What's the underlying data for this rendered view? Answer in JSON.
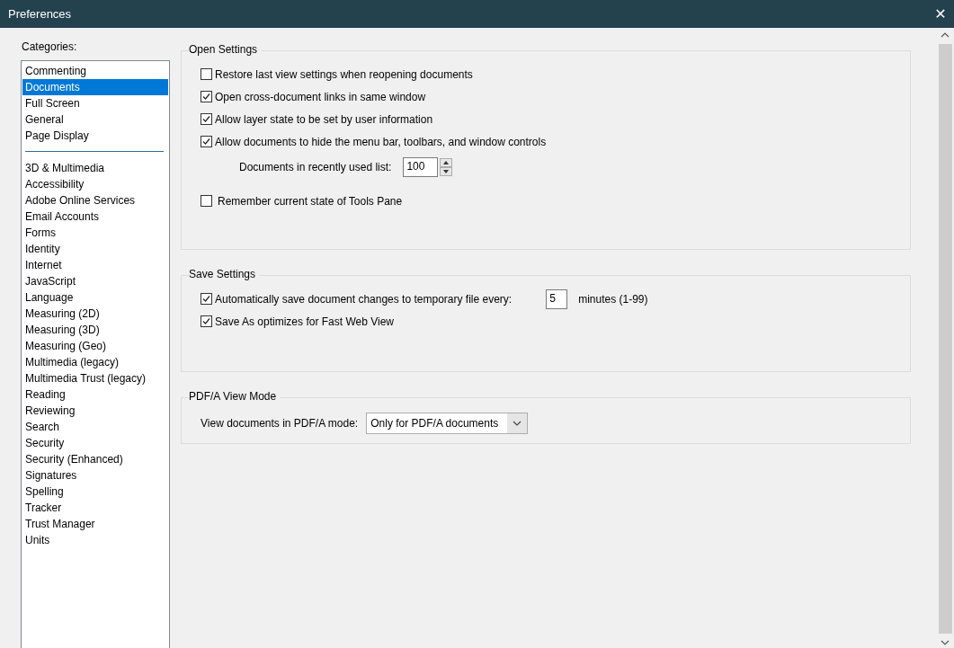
{
  "window": {
    "title": "Preferences",
    "close_glyph": "✕"
  },
  "categories": {
    "label": "Categories:",
    "groups": [
      [
        {
          "label": "Commenting",
          "selected": false
        },
        {
          "label": "Documents",
          "selected": true
        },
        {
          "label": "Full Screen",
          "selected": false
        },
        {
          "label": "General",
          "selected": false
        },
        {
          "label": "Page Display",
          "selected": false
        }
      ],
      [
        {
          "label": "3D & Multimedia",
          "selected": false
        },
        {
          "label": "Accessibility",
          "selected": false
        },
        {
          "label": "Adobe Online Services",
          "selected": false
        },
        {
          "label": "Email Accounts",
          "selected": false
        },
        {
          "label": "Forms",
          "selected": false
        },
        {
          "label": "Identity",
          "selected": false
        },
        {
          "label": "Internet",
          "selected": false
        },
        {
          "label": "JavaScript",
          "selected": false
        },
        {
          "label": "Language",
          "selected": false
        },
        {
          "label": "Measuring (2D)",
          "selected": false
        },
        {
          "label": "Measuring (3D)",
          "selected": false
        },
        {
          "label": "Measuring (Geo)",
          "selected": false
        },
        {
          "label": "Multimedia (legacy)",
          "selected": false
        },
        {
          "label": "Multimedia Trust (legacy)",
          "selected": false
        },
        {
          "label": "Reading",
          "selected": false
        },
        {
          "label": "Reviewing",
          "selected": false
        },
        {
          "label": "Search",
          "selected": false
        },
        {
          "label": "Security",
          "selected": false
        },
        {
          "label": "Security (Enhanced)",
          "selected": false
        },
        {
          "label": "Signatures",
          "selected": false
        },
        {
          "label": "Spelling",
          "selected": false
        },
        {
          "label": "Tracker",
          "selected": false
        },
        {
          "label": "Trust Manager",
          "selected": false
        },
        {
          "label": "Units",
          "selected": false
        }
      ]
    ]
  },
  "sections": [
    {
      "title": "Open Settings",
      "items": [
        {
          "kind": "checkbox",
          "label": "Restore last view settings when reopening documents",
          "checked": false
        },
        {
          "kind": "checkbox",
          "label": "Open cross-document links in same window",
          "checked": true
        },
        {
          "kind": "checkbox",
          "label": "Allow layer state to be set by user information",
          "checked": true
        },
        {
          "kind": "checkbox",
          "label": "Allow documents to hide the menu bar, toolbars, and window controls",
          "checked": true
        },
        {
          "kind": "spinner",
          "label": "Documents in recently used list:",
          "value": "100"
        },
        {
          "kind": "checkbox",
          "label": "Remember current state of Tools Pane",
          "checked": false
        }
      ]
    },
    {
      "title": "Save Settings",
      "items": [
        {
          "kind": "checkbox",
          "label": "Automatically save document changes to temporary file every:",
          "checked": true,
          "value": "5",
          "unit": "minutes (1-99)"
        },
        {
          "kind": "checkbox",
          "label": "Save As optimizes for Fast Web View",
          "checked": true
        }
      ]
    },
    {
      "title": "PDF/A View Mode",
      "items": [
        {
          "kind": "dropdown",
          "label": "View documents in PDF/A mode:",
          "value": "Only for PDF/A documents"
        }
      ]
    }
  ]
}
